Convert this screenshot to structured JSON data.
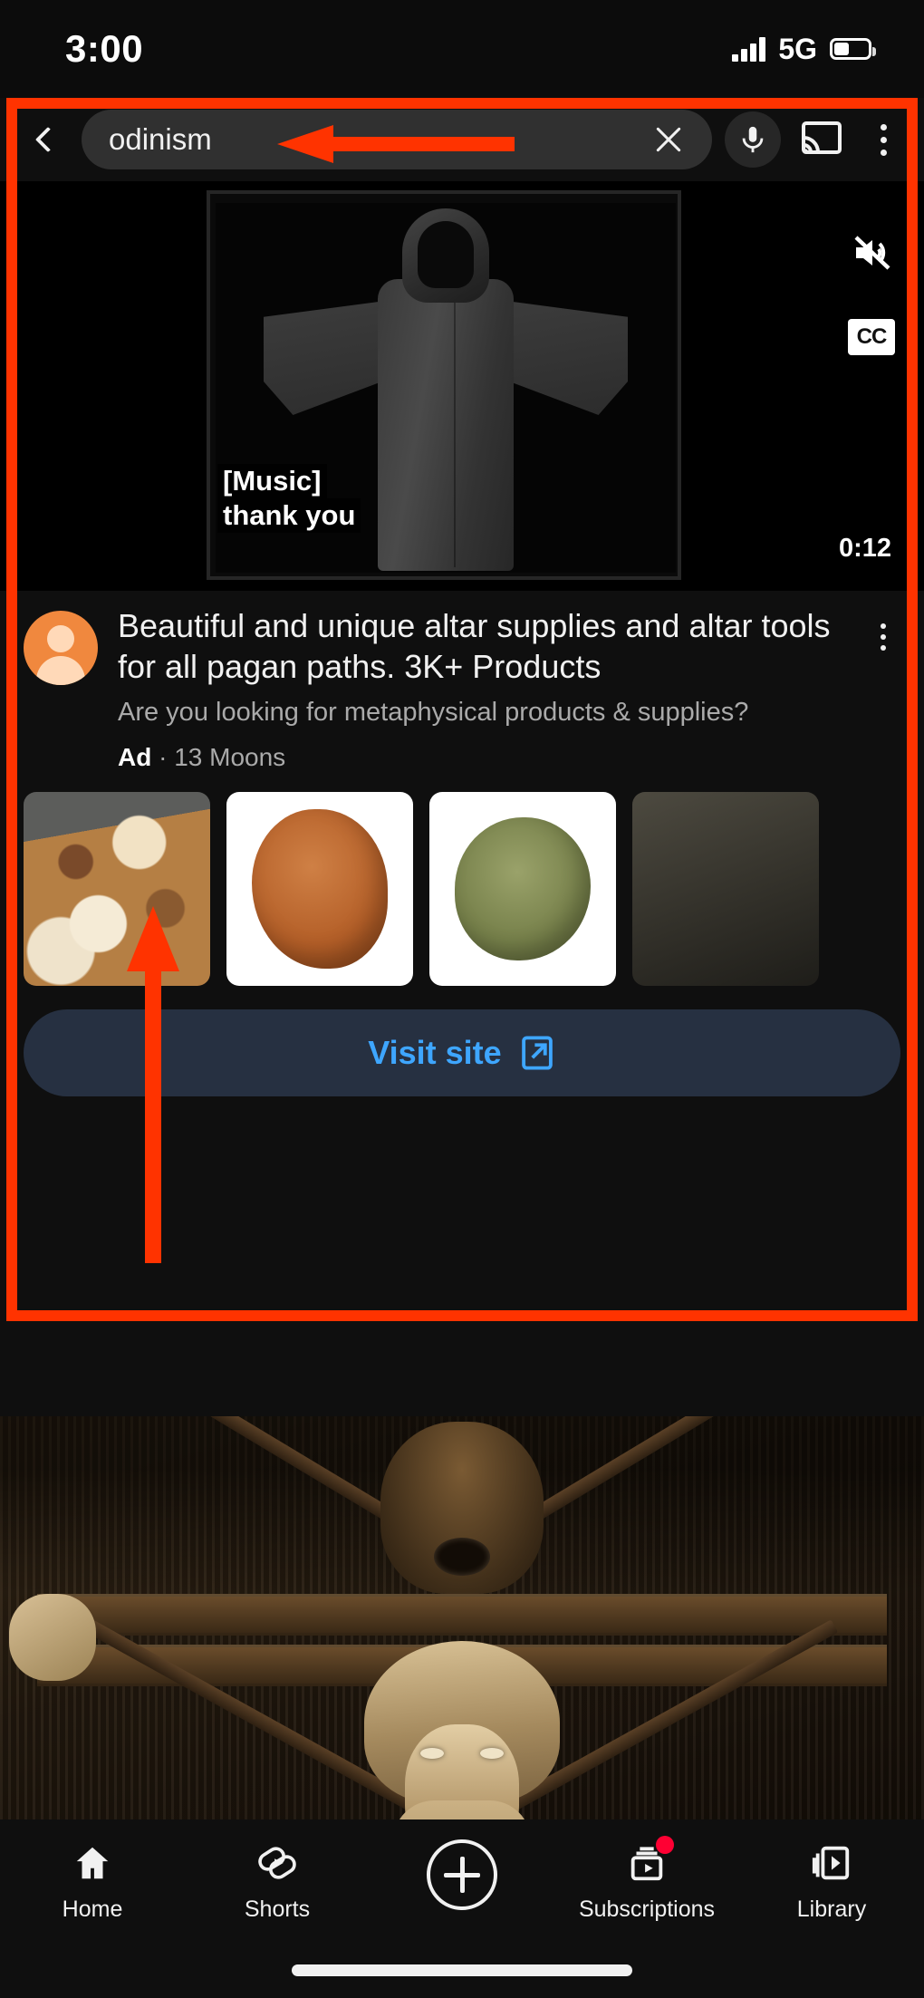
{
  "status_bar": {
    "time": "3:00",
    "network": "5G",
    "signal_icon": "signal-bars-icon",
    "battery_icon": "battery-icon"
  },
  "search_header": {
    "back_icon": "back-chevron-icon",
    "query": "odinism",
    "clear_icon": "clear-x-icon",
    "mic_icon": "microphone-icon",
    "cast_icon": "cast-icon",
    "overflow_icon": "more-vertical-icon"
  },
  "player": {
    "caption_line_1": "[Music]",
    "caption_line_2": "thank you",
    "duration": "0:12",
    "mute_icon": "volume-muted-icon",
    "cc_label": "CC"
  },
  "ad": {
    "avatar_icon": "channel-avatar-icon",
    "title": "Beautiful and unique altar supplies and altar tools for all pagan paths. 3K+ Products",
    "subtitle": "Are you looking for metaphysical products & supplies?",
    "badge": "Ad",
    "separator": "·",
    "advertiser": "13 Moons",
    "overflow_icon": "more-vertical-icon",
    "products": [
      {
        "name": "resin-incense-on-wood-plate"
      },
      {
        "name": "brown-powder-incense"
      },
      {
        "name": "dried-green-herbs"
      },
      {
        "name": "dark-dried-herbs"
      }
    ],
    "cta_label": "Visit site",
    "cta_icon": "external-link-icon"
  },
  "lower_video": {
    "thumbnail_name": "norse-wood-carving-odin-thumbnail"
  },
  "bottom_nav": {
    "items": [
      {
        "label": "Home",
        "icon": "home-icon"
      },
      {
        "label": "Shorts",
        "icon": "shorts-icon"
      },
      {
        "label": "",
        "icon": "create-plus-icon"
      },
      {
        "label": "Subscriptions",
        "icon": "subscriptions-icon",
        "badge": true
      },
      {
        "label": "Library",
        "icon": "library-icon"
      }
    ]
  },
  "annotations": {
    "highlight_box_color": "#ff3300",
    "arrow_search_name": "red-arrow-pointing-to-search-query",
    "arrow_ad_name": "red-arrow-pointing-to-ad-badge"
  }
}
